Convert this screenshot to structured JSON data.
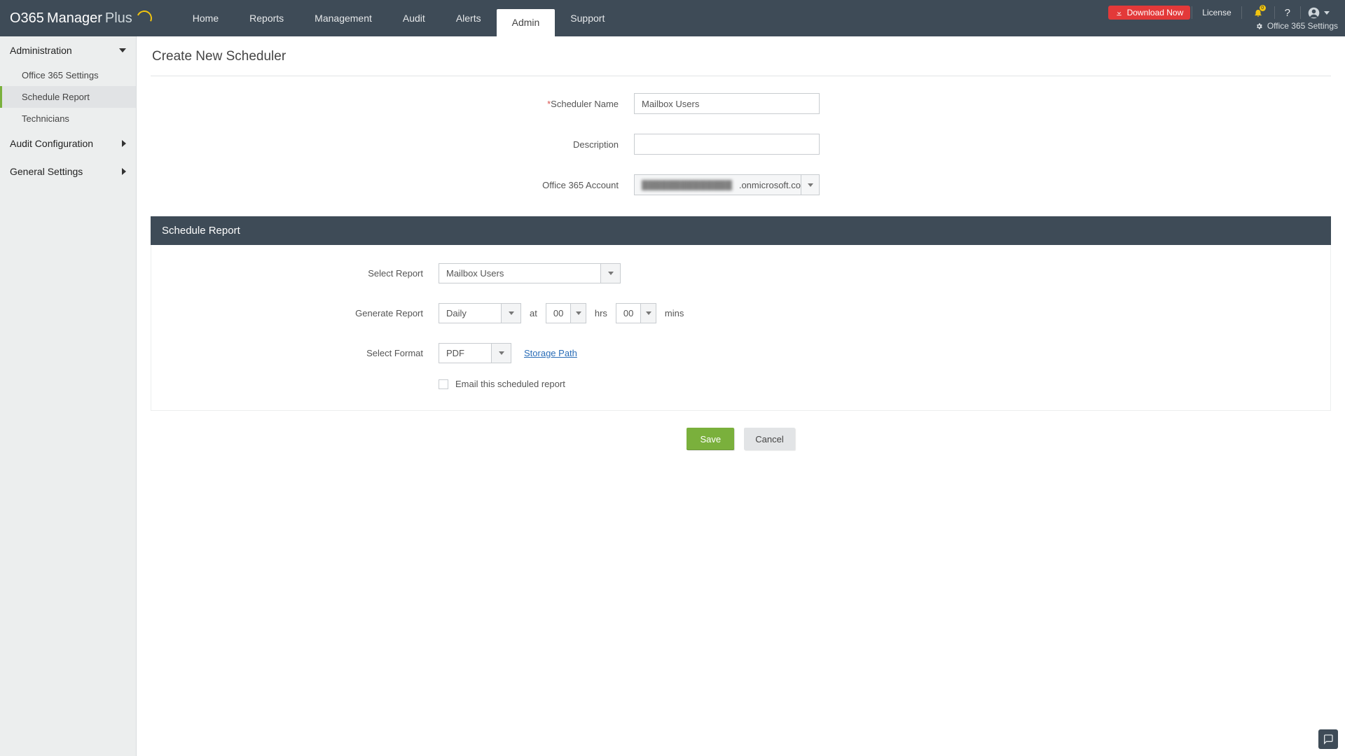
{
  "app": {
    "name_part1": "O365",
    "name_part2": "Manager",
    "name_part3": "Plus"
  },
  "topnav": {
    "items": [
      {
        "label": "Home"
      },
      {
        "label": "Reports"
      },
      {
        "label": "Management"
      },
      {
        "label": "Audit"
      },
      {
        "label": "Alerts"
      },
      {
        "label": "Admin",
        "active": true
      },
      {
        "label": "Support"
      }
    ]
  },
  "topright": {
    "download": "Download Now",
    "license": "License",
    "notifications_count": "0",
    "settings_link": "Office 365 Settings"
  },
  "sidebar": {
    "sections": [
      {
        "label": "Administration",
        "expanded": true
      },
      {
        "label": "Audit Configuration",
        "expanded": false
      },
      {
        "label": "General Settings",
        "expanded": false
      }
    ],
    "admin_items": [
      {
        "label": "Office 365 Settings"
      },
      {
        "label": "Schedule Report",
        "active": true
      },
      {
        "label": "Technicians"
      }
    ]
  },
  "page": {
    "title": "Create New Scheduler",
    "form": {
      "scheduler_name_label": "Scheduler Name",
      "scheduler_name_value": "Mailbox Users",
      "description_label": "Description",
      "description_value": "",
      "account_label": "Office 365 Account",
      "account_value_suffix": ".onmicrosoft.co"
    },
    "section_title": "Schedule Report",
    "schedule": {
      "select_report_label": "Select Report",
      "select_report_value": "Mailbox Users",
      "generate_label": "Generate Report",
      "frequency": "Daily",
      "at": "at",
      "hours": "00",
      "hrs": "hrs",
      "minutes": "00",
      "mins": "mins",
      "format_label": "Select Format",
      "format_value": "PDF",
      "storage_path": "Storage Path",
      "email_label": "Email this scheduled report"
    },
    "actions": {
      "save": "Save",
      "cancel": "Cancel"
    }
  }
}
